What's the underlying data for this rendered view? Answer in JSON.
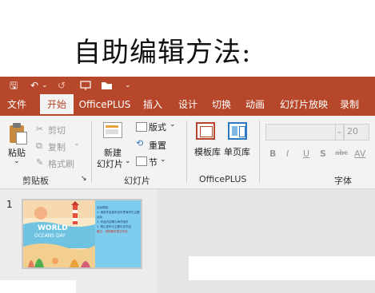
{
  "heading": {
    "text": "自助编辑方法:"
  },
  "qat": {
    "save": "🖫",
    "undo": "↶",
    "undo_drop": "⌄",
    "redo": "↺",
    "more": "⌄"
  },
  "tabs": [
    "文件",
    "开始",
    "OfficePLUS",
    "插入",
    "设计",
    "切换",
    "动画",
    "幻灯片放映",
    "录制"
  ],
  "clipboard": {
    "paste": "粘贴",
    "cut": "剪切",
    "copy": "复制",
    "format_painter": "格式刷",
    "label": "剪贴板"
  },
  "slides": {
    "new_slide": "新建",
    "new_slide_2": "幻灯片",
    "layout": "版式",
    "reset": "重置",
    "section": "节",
    "label": "幻灯片"
  },
  "officeplus": {
    "template_lib": "模板库",
    "single_page_lib": "单页库",
    "label": "OfficePLUS"
  },
  "font": {
    "size": "20",
    "bold": "B",
    "italic": "I",
    "underline": "U",
    "shadow": "S",
    "strike": "abc",
    "spacing": "AV",
    "label": "字体"
  },
  "thumbnail": {
    "number": "1",
    "title_line1": "WORLD",
    "title_line2": "OCEANS DAY",
    "notes": [
      "活动规则：",
      "1. 请将作品发布至世界海洋日主题活动",
      "2. 作品内容需与海洋相关",
      "3. 禁止发布与主题无关内容",
      "备注：请按要求提交作品"
    ]
  },
  "colors": {
    "accent": "#b7472a",
    "ribbon_bg": "#f3f3f3",
    "slide_blue": "#7fcdee"
  }
}
